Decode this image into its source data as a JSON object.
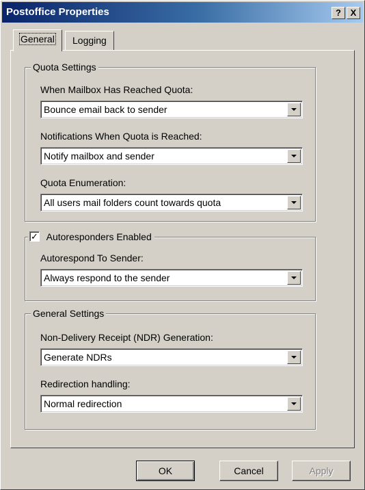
{
  "window": {
    "title": "Postoffice Properties",
    "help_btn": "?",
    "close_btn": "X"
  },
  "tabs": [
    {
      "label": "General",
      "active": true
    },
    {
      "label": "Logging",
      "active": false
    }
  ],
  "quota": {
    "legend": "Quota Settings",
    "reached_label": "When Mailbox Has Reached Quota:",
    "reached_value": "Bounce email back to sender",
    "notify_label": "Notifications When Quota is Reached:",
    "notify_value": "Notify mailbox and sender",
    "enum_label": "Quota Enumeration:",
    "enum_value": "All users mail folders count towards quota"
  },
  "autoresponders": {
    "check_mark": "✓",
    "checked": true,
    "legend": "Autoresponders Enabled",
    "sender_label": "Autorespond To Sender:",
    "sender_value": "Always respond to the sender"
  },
  "general": {
    "legend": "General Settings",
    "ndr_label": "Non-Delivery Receipt (NDR) Generation:",
    "ndr_value": "Generate NDRs",
    "redir_label": "Redirection handling:",
    "redir_value": "Normal redirection"
  },
  "buttons": {
    "ok": "OK",
    "cancel": "Cancel",
    "apply": "Apply"
  }
}
